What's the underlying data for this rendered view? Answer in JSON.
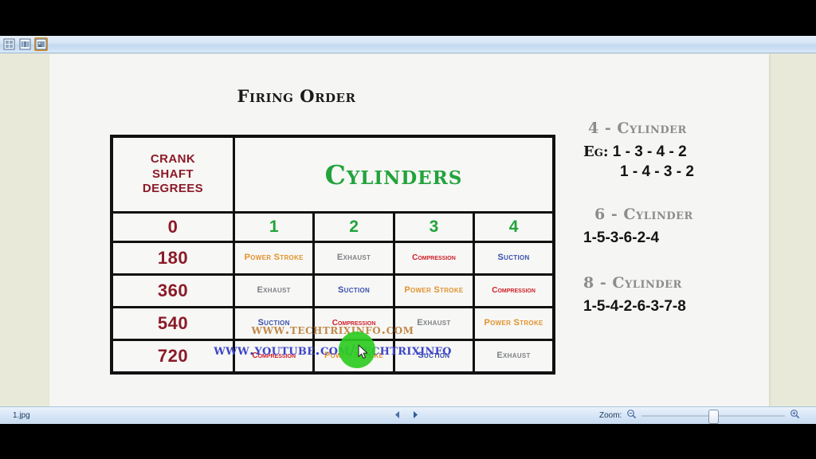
{
  "toolbar": {
    "buttons": [
      {
        "name": "thumbnail-view-icon",
        "label": "Thumbnail View",
        "active": false
      },
      {
        "name": "filmstrip-view-icon",
        "label": "Filmstrip View",
        "active": false
      },
      {
        "name": "single-image-view-icon",
        "label": "Single Image View",
        "active": true
      }
    ]
  },
  "slide": {
    "title": "Firing Order",
    "table": {
      "header_degrees": "CRANK\nSHAFT\nDEGREES",
      "header_degrees_lines": [
        "CRANK",
        "SHAFT",
        "DEGREES"
      ],
      "header_cylinders": "Cylinders",
      "column_numbers": [
        "0",
        "1",
        "2",
        "3",
        "4"
      ],
      "rows": [
        {
          "degrees": "180",
          "cells": [
            {
              "text": "Power Stroke",
              "type": "power"
            },
            {
              "text": "Exhaust",
              "type": "exhaust"
            },
            {
              "text": "Compression",
              "type": "compression"
            },
            {
              "text": "Suction",
              "type": "suction"
            }
          ]
        },
        {
          "degrees": "360",
          "cells": [
            {
              "text": "Exhaust",
              "type": "exhaust"
            },
            {
              "text": "Suction",
              "type": "suction"
            },
            {
              "text": "Power Stroke",
              "type": "power"
            },
            {
              "text": "Compression",
              "type": "compression"
            }
          ]
        },
        {
          "degrees": "540",
          "cells": [
            {
              "text": "Suction",
              "type": "suction"
            },
            {
              "text": "Compression",
              "type": "compression"
            },
            {
              "text": "Exhaust",
              "type": "exhaust"
            },
            {
              "text": "Power Stroke",
              "type": "power"
            }
          ]
        },
        {
          "degrees": "720",
          "cells": [
            {
              "text": "Compression",
              "type": "compression"
            },
            {
              "text": "Power Stroke",
              "type": "power"
            },
            {
              "text": "Suction",
              "type": "suction"
            },
            {
              "text": "Exhaust",
              "type": "exhaust"
            }
          ]
        }
      ]
    },
    "footer": {
      "website": "www.techtrixinfo.com",
      "youtube": "www.youtube.com/techtrixinfo"
    },
    "side_panel": {
      "group4": {
        "heading": "4 - Cylinder",
        "order_primary_prefix": "Eg:",
        "order_primary": "1 - 3 - 4 - 2",
        "order_secondary": "1 - 4 - 3 - 2"
      },
      "group6": {
        "heading": "6 - Cylinder",
        "order": "1-5-3-6-2-4"
      },
      "group8": {
        "heading": "8 - Cylinder",
        "order": "1-5-4-2-6-3-7-8"
      }
    }
  },
  "status_bar": {
    "filename": "1.jpg",
    "prev_label": "Previous",
    "next_label": "Next",
    "zoom_label": "Zoom:",
    "zoom_out_label": "Zoom Out",
    "zoom_in_label": "Zoom In",
    "zoom_value": "50"
  },
  "colors": {
    "power_stroke": "#e2922e",
    "exhaust": "#7f8285",
    "compression": "#d0202a",
    "suction": "#3a4fb0",
    "degrees": "#8b1a28",
    "cylinders_green": "#22a33c",
    "website_link": "#c08a4a",
    "youtube_link": "#3c46c8",
    "click_highlight": "#2ecc22",
    "toolbar_active": "#f5a93c"
  }
}
